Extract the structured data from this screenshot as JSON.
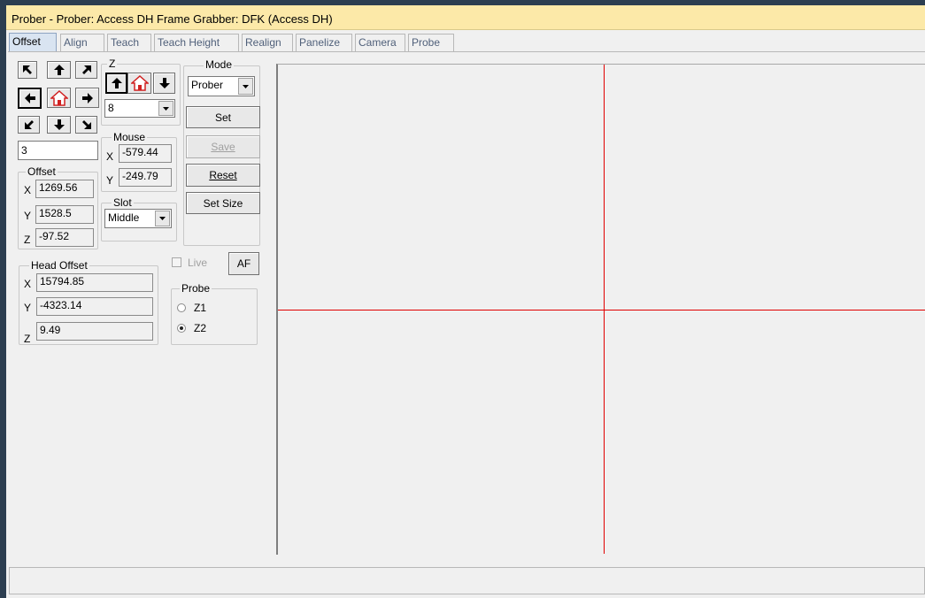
{
  "window": {
    "title": "Prober - Prober: Access DH Frame Grabber: DFK (Access DH)"
  },
  "tabs": [
    {
      "label": "Offset",
      "active": true
    },
    {
      "label": "Align"
    },
    {
      "label": "Teach"
    },
    {
      "label": "Teach Height"
    },
    {
      "label": "Realign"
    },
    {
      "label": "Panelize"
    },
    {
      "label": "Camera"
    },
    {
      "label": "Probe"
    }
  ],
  "jog": {
    "buttons": [
      "up-left",
      "up",
      "up-right",
      "left",
      "home",
      "right",
      "down-left",
      "down",
      "down-right"
    ],
    "step_value": "3"
  },
  "z_group": {
    "label": "Z",
    "buttons": [
      "z-up",
      "z-home",
      "z-down"
    ],
    "step_value": "8"
  },
  "mode_group": {
    "label": "Mode",
    "selected": "Prober"
  },
  "buttons": {
    "set": "Set",
    "save": "Save",
    "reset": "Reset",
    "set_size": "Set Size",
    "af": "AF"
  },
  "mouse_group": {
    "label": "Mouse",
    "x_label": "X",
    "x_value": "-579.44",
    "y_label": "Y",
    "y_value": "-249.79"
  },
  "offset_group": {
    "label": "Offset",
    "x_label": "X",
    "x_value": "1269.56",
    "y_label": "Y",
    "y_value": "1528.5",
    "z_label": "Z",
    "z_value": "-97.52"
  },
  "slot_group": {
    "label": "Slot",
    "selected": "Middle"
  },
  "live": {
    "label": "Live",
    "checked": false
  },
  "head_offset_group": {
    "label": "Head Offset",
    "x_label": "X",
    "x_value": "15794.85",
    "y_label": "Y",
    "y_value": "-4323.14",
    "z_label": "Z",
    "z_value": "9.49"
  },
  "probe_group": {
    "label": "Probe",
    "options": [
      {
        "label": "Z1",
        "selected": false
      },
      {
        "label": "Z2",
        "selected": true
      }
    ]
  },
  "colors": {
    "crosshair": "#e00000",
    "title_bar": "#fce9a8",
    "active_tab": "#d9e4f1"
  }
}
